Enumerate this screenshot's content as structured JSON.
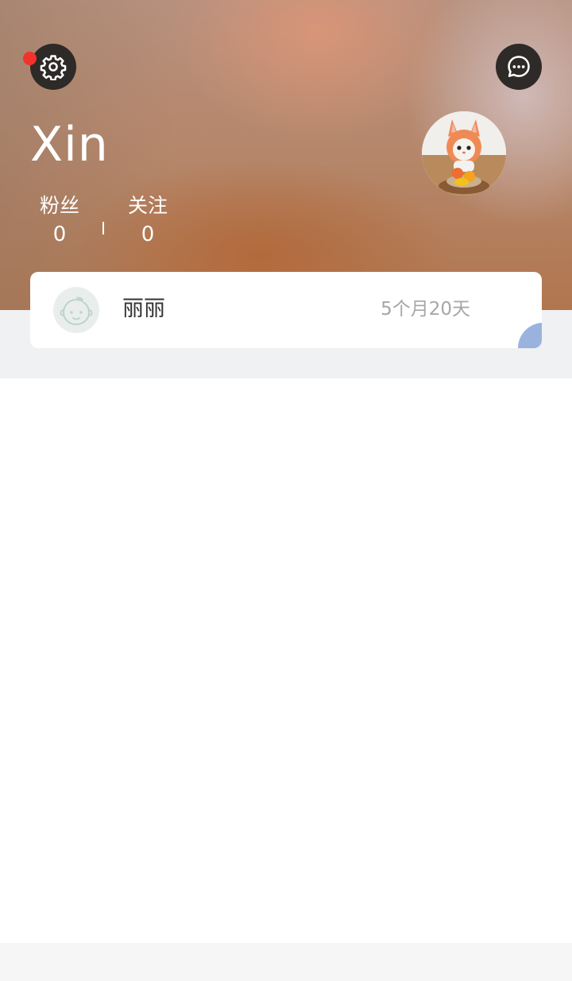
{
  "profile": {
    "username": "Xin",
    "stats": {
      "fans_label": "粉丝",
      "fans_value": "0",
      "follow_label": "关注",
      "follow_value": "0"
    }
  },
  "icons": {
    "settings": "gear-icon",
    "message": "chat-bubble-icon",
    "notify": "red-dot-badge",
    "baby_avatar": "baby-face-icon"
  },
  "baby": {
    "name": "丽丽",
    "age": "5个月20天"
  },
  "colors": {
    "notify_dot": "#f2332b",
    "icon_button_bg": "#2e2a28",
    "age_text": "#a6a6a6",
    "corner_badge": "#9ab3de",
    "card_area_bg": "#eff1f2"
  }
}
